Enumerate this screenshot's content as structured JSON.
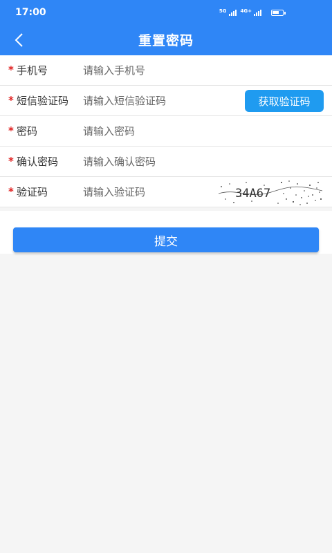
{
  "status_bar": {
    "time": "17:00",
    "network1": "5G",
    "network2": "4G+"
  },
  "header": {
    "title": "重置密码"
  },
  "form": {
    "required_mark": "*",
    "fields": [
      {
        "label": "手机号",
        "placeholder": "请输入手机号"
      },
      {
        "label": "短信验证码",
        "placeholder": "请输入短信验证码"
      },
      {
        "label": "密码",
        "placeholder": "请输入密码"
      },
      {
        "label": "确认密码",
        "placeholder": "请输入确认密码"
      },
      {
        "label": "验证码",
        "placeholder": "请输入验证码"
      }
    ],
    "sms_button_label": "获取验证码",
    "captcha_text": "34A67"
  },
  "submit_label": "提交",
  "colors": {
    "primary": "#2f86f6",
    "sms_button": "#1f9bf0",
    "required": "#e02020",
    "background": "#f5f5f5"
  }
}
